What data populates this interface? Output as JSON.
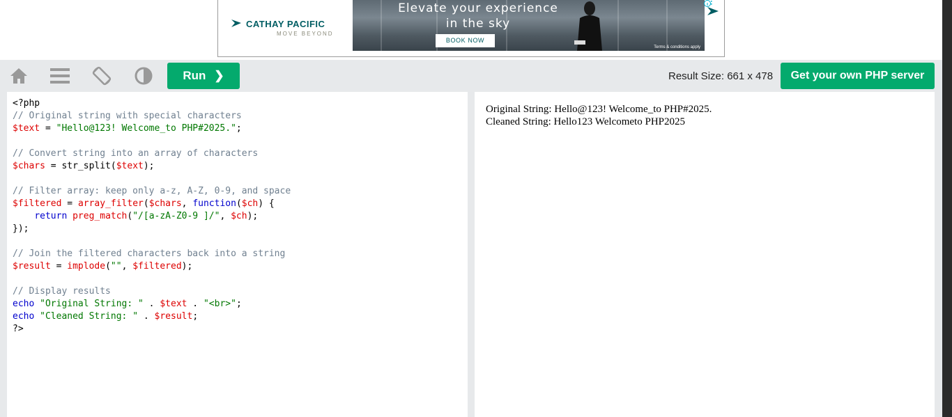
{
  "ad": {
    "brand": "CATHAY PACIFIC",
    "tagline": "MOVE BEYOND",
    "headline_line1": "Elevate your experience",
    "headline_line2": "in the sky",
    "cta": "BOOK NOW",
    "terms": "Terms & conditions apply",
    "brand_color": "#005d63"
  },
  "toolbar": {
    "icons": [
      "home-icon",
      "menu-icon",
      "rotate-icon",
      "contrast-icon"
    ],
    "run_label": "Run",
    "run_chevron": "❯",
    "result_size": "Result Size: 661 x 478",
    "get_server_label": "Get your own PHP server",
    "accent_color": "#04aa6d"
  },
  "code": {
    "lines": [
      [
        {
          "t": "<?php",
          "c": "plain"
        }
      ],
      [
        {
          "t": "// Original string with special characters",
          "c": "comment"
        }
      ],
      [
        {
          "t": "$text",
          "c": "var"
        },
        {
          "t": " = ",
          "c": "plain"
        },
        {
          "t": "\"Hello@123! Welcome_to PHP#2025.\"",
          "c": "str"
        },
        {
          "t": ";",
          "c": "plain"
        }
      ],
      [],
      [
        {
          "t": "// Convert string into an array of characters",
          "c": "comment"
        }
      ],
      [
        {
          "t": "$chars",
          "c": "var"
        },
        {
          "t": " = str_split(",
          "c": "plain"
        },
        {
          "t": "$text",
          "c": "var"
        },
        {
          "t": ");",
          "c": "plain"
        }
      ],
      [],
      [
        {
          "t": "// Filter array: keep only a-z, A-Z, 0-9, and space",
          "c": "comment"
        }
      ],
      [
        {
          "t": "$filtered",
          "c": "var"
        },
        {
          "t": " = ",
          "c": "plain"
        },
        {
          "t": "array_filter",
          "c": "fn"
        },
        {
          "t": "(",
          "c": "plain"
        },
        {
          "t": "$chars",
          "c": "var"
        },
        {
          "t": ", ",
          "c": "plain"
        },
        {
          "t": "function",
          "c": "kw"
        },
        {
          "t": "(",
          "c": "plain"
        },
        {
          "t": "$ch",
          "c": "var"
        },
        {
          "t": ") {",
          "c": "plain"
        }
      ],
      [
        {
          "t": "    ",
          "c": "plain"
        },
        {
          "t": "return",
          "c": "kw"
        },
        {
          "t": " ",
          "c": "plain"
        },
        {
          "t": "preg_match",
          "c": "fn"
        },
        {
          "t": "(",
          "c": "plain"
        },
        {
          "t": "\"/[a-zA-Z0-9 ]/\"",
          "c": "str"
        },
        {
          "t": ", ",
          "c": "plain"
        },
        {
          "t": "$ch",
          "c": "var"
        },
        {
          "t": ");",
          "c": "plain"
        }
      ],
      [
        {
          "t": "});",
          "c": "plain"
        }
      ],
      [],
      [
        {
          "t": "// Join the filtered characters back into a string",
          "c": "comment"
        }
      ],
      [
        {
          "t": "$result",
          "c": "var"
        },
        {
          "t": " = ",
          "c": "plain"
        },
        {
          "t": "implode",
          "c": "fn"
        },
        {
          "t": "(",
          "c": "plain"
        },
        {
          "t": "\"\"",
          "c": "str"
        },
        {
          "t": ", ",
          "c": "plain"
        },
        {
          "t": "$filtered",
          "c": "var"
        },
        {
          "t": ");",
          "c": "plain"
        }
      ],
      [],
      [
        {
          "t": "// Display results",
          "c": "comment"
        }
      ],
      [
        {
          "t": "echo",
          "c": "kw"
        },
        {
          "t": " ",
          "c": "plain"
        },
        {
          "t": "\"Original String: \"",
          "c": "str"
        },
        {
          "t": " . ",
          "c": "plain"
        },
        {
          "t": "$text",
          "c": "var"
        },
        {
          "t": " . ",
          "c": "plain"
        },
        {
          "t": "\"<br>\"",
          "c": "str"
        },
        {
          "t": ";",
          "c": "plain"
        }
      ],
      [
        {
          "t": "echo",
          "c": "kw"
        },
        {
          "t": " ",
          "c": "plain"
        },
        {
          "t": "\"Cleaned String: \"",
          "c": "str"
        },
        {
          "t": " . ",
          "c": "plain"
        },
        {
          "t": "$result",
          "c": "var"
        },
        {
          "t": ";",
          "c": "plain"
        }
      ],
      [
        {
          "t": "?>",
          "c": "plain"
        }
      ]
    ]
  },
  "output": {
    "line1": "Original String: Hello@123! Welcome_to PHP#2025.",
    "line2": "Cleaned String: Hello123 Welcometo PHP2025"
  }
}
